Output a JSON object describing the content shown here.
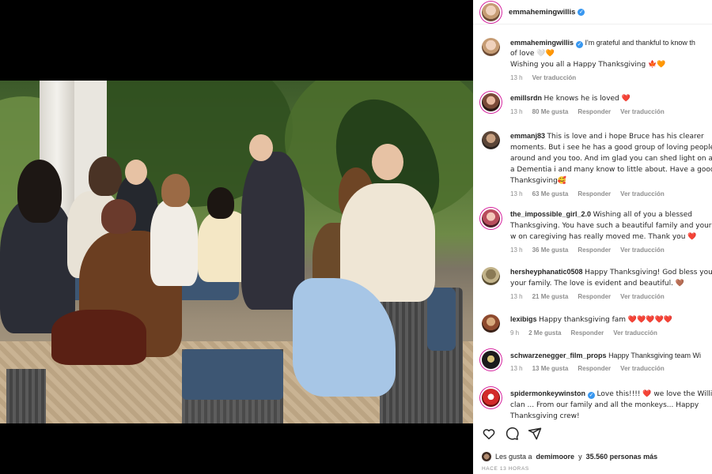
{
  "post": {
    "author": "emmahemingwillis",
    "caption": {
      "username": "emmahemingwillis",
      "line1": "I'm grateful and thankful to know th",
      "line2": "of love 🤍🧡",
      "line3": "Wishing you all a Happy Thanksgiving 🍁🧡",
      "time": "13 h",
      "translate": "Ver traducción"
    }
  },
  "comments": [
    {
      "username": "emillsrdn",
      "text": "He knows he is loved ❤️",
      "time": "13 h",
      "likes": "80 Me gusta",
      "reply": "Responder",
      "translate": "Ver traducción"
    },
    {
      "username": "emmanj83",
      "text": "This is love and i hope Bruce has his clearer moments. But i see he has a good group of loving people around and you too. And im glad you can shed light on a t a Dementia i and many know to little about. Have a good Thanksgiving🥰",
      "time": "13 h",
      "likes": "63 Me gusta",
      "reply": "Responder",
      "translate": "Ver traducción"
    },
    {
      "username": "the_impossible_girl_2.0",
      "text": "Wishing all of you a blessed Thanksgiving. You have such a beautiful family and your w on caregiving has really moved me. Thank you ❤️",
      "time": "13 h",
      "likes": "36 Me gusta",
      "reply": "Responder",
      "translate": "Ver traducción"
    },
    {
      "username": "hersheyphanatic0508",
      "text": "Happy Thanksgiving! God bless you your family. The love is evident and beautiful. 🤎",
      "time": "13 h",
      "likes": "21 Me gusta",
      "reply": "Responder",
      "translate": "Ver traducción"
    },
    {
      "username": "lexibigs",
      "text": "Happy thanksgiving fam ❤️❤️❤️❤️❤️",
      "time": "9 h",
      "likes": "2 Me gusta",
      "reply": "Responder",
      "translate": "Ver traducción"
    },
    {
      "username": "schwarzenegger_film_props",
      "text": "Happy Thanksgiving team Wi",
      "time": "13 h",
      "likes": "13 Me gusta",
      "reply": "Responder",
      "translate": "Ver traducción"
    },
    {
      "username": "spidermonkeywinston",
      "text": "Love this!!!! ❤️ we love the Willi clan ... From our family and all the monkeys... Happy Thanksgiving crew!",
      "time": "13 h",
      "likes": "",
      "reply": "",
      "translate": ""
    }
  ],
  "footer": {
    "likes_prefix": "Les gusta a",
    "likes_user": "demimoore",
    "likes_suffix": "y",
    "likes_count": "35.560 personas más",
    "timeago": "Hace 13 horas"
  },
  "colors": {
    "verified": "#3897f0",
    "heart": "#ed4956",
    "muted": "#8e8e8e"
  }
}
